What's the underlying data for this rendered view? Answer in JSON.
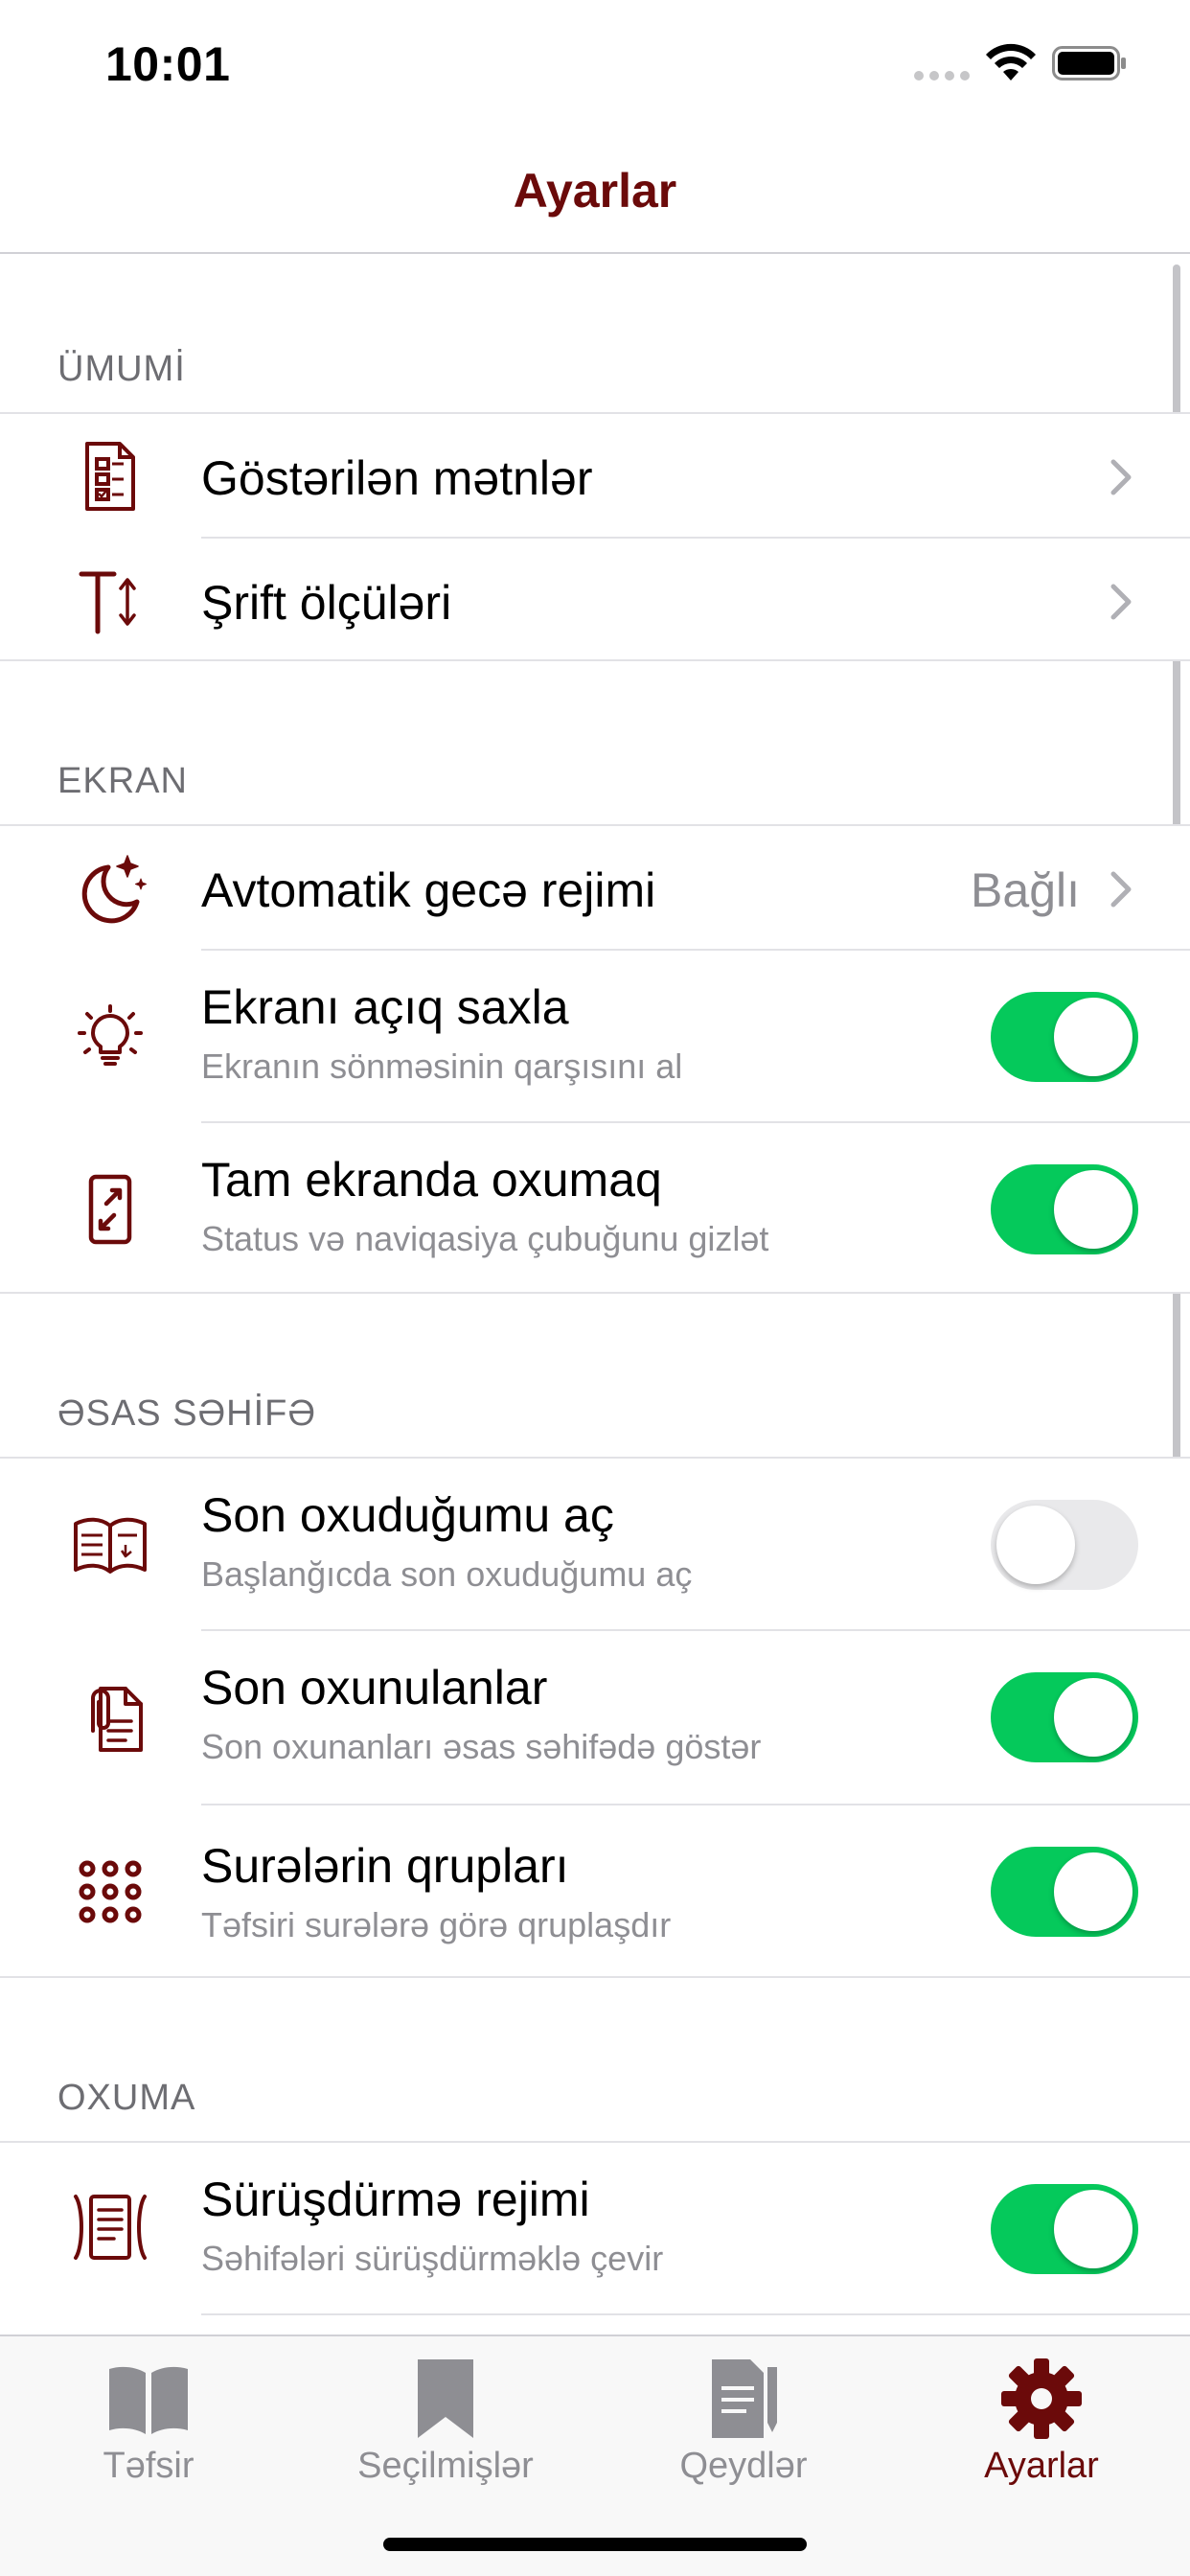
{
  "status_bar": {
    "time": "10:01"
  },
  "nav": {
    "title": "Ayarlar"
  },
  "sections": [
    {
      "header": "ÜMUMİ",
      "rows": [
        {
          "icon": "checklist-document-icon",
          "title": "Göstərilən mətnlər"
        },
        {
          "icon": "text-size-icon",
          "title": "Şrift ölçüləri"
        }
      ]
    },
    {
      "header": "EKRAN",
      "rows": [
        {
          "icon": "moon-stars-icon",
          "title": "Avtomatik gecə rejimi",
          "value": "Bağlı"
        },
        {
          "icon": "lightbulb-icon",
          "title": "Ekranı açıq saxla",
          "subtitle": "Ekranın sönməsinin qarşısını al",
          "toggle": true
        },
        {
          "icon": "fullscreen-icon",
          "title": "Tam ekranda oxumaq",
          "subtitle": "Status və naviqasiya çubuğunu gizlət",
          "toggle": true
        }
      ]
    },
    {
      "header": "ƏSAS SƏHİFƏ",
      "rows": [
        {
          "icon": "open-book-icon",
          "title": "Son oxuduğumu aç",
          "subtitle": "Başlanğıcda son oxuduğumu aç",
          "toggle": false
        },
        {
          "icon": "attachment-document-icon",
          "title": "Son oxunulanlar",
          "subtitle": "Son oxunanları əsas səhifədə göstər",
          "toggle": true
        },
        {
          "icon": "dots-grid-icon",
          "title": "Surələrin qrupları",
          "subtitle": "Təfsiri surələrə görə qruplaşdır",
          "toggle": true
        }
      ]
    },
    {
      "header": "OXUMA",
      "rows": [
        {
          "icon": "scroll-page-icon",
          "title": "Sürüşdürmə rejimi",
          "subtitle": "Səhifələri sürüşdürməklə çevir",
          "toggle": true
        }
      ]
    }
  ],
  "tabs": [
    {
      "label": "Təfsir",
      "icon": "book-icon",
      "active": false
    },
    {
      "label": "Seçilmişlər",
      "icon": "bookmark-icon",
      "active": false
    },
    {
      "label": "Qeydlər",
      "icon": "notes-icon",
      "active": false
    },
    {
      "label": "Ayarlar",
      "icon": "gear-icon",
      "active": true
    }
  ],
  "colors": {
    "accent": "#6b0a0a",
    "toggle_on": "#05c95b",
    "toggle_off": "#e9e9eb",
    "secondary_text": "#8e8e93",
    "tab_inactive": "#8e8e93"
  }
}
